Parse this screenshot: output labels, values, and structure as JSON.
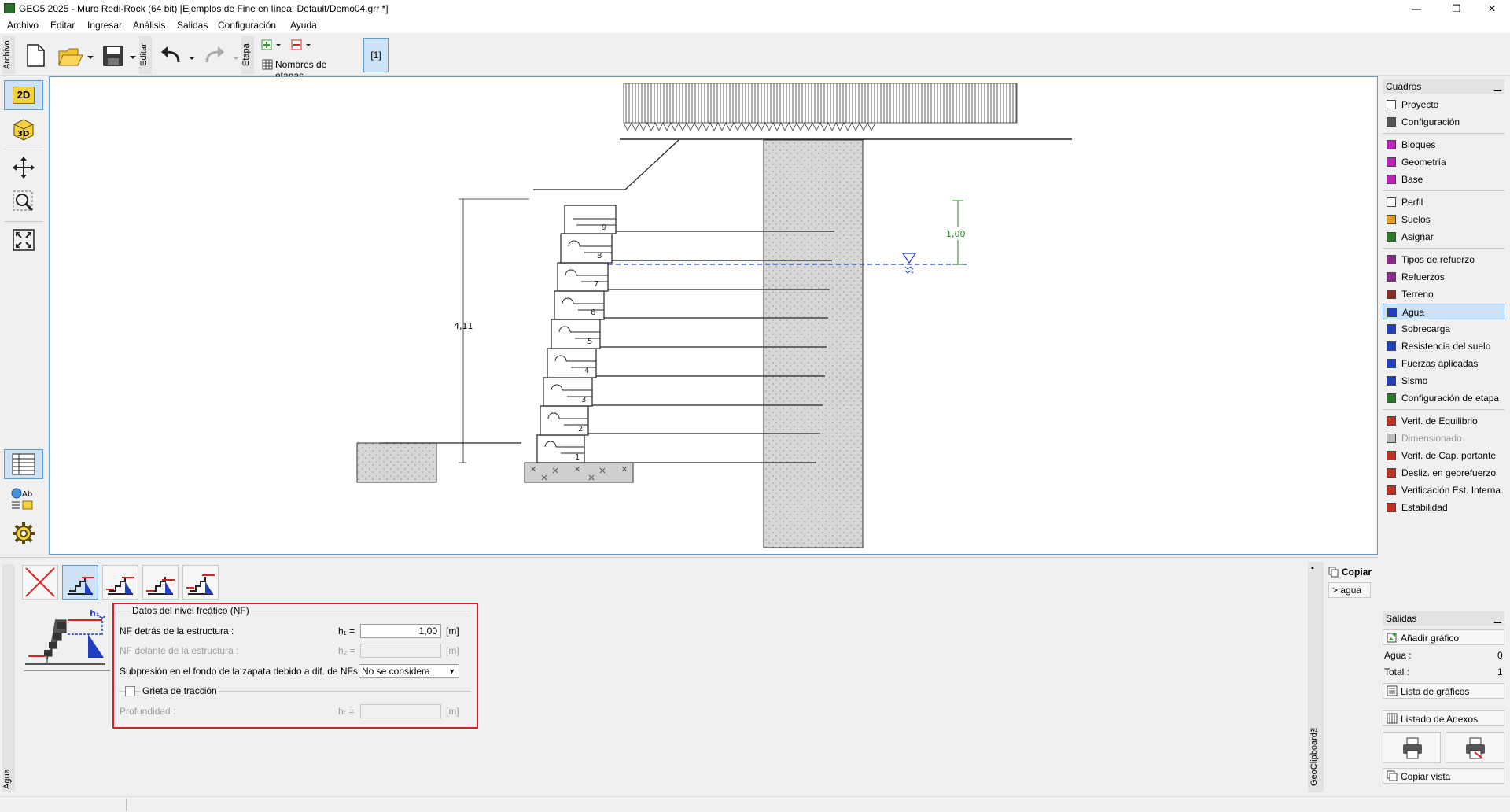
{
  "window": {
    "title": "GEO5 2025 - Muro Redi-Rock  (64 bit) [Ejemplos de Fine en línea: Default/Demo04.grr *]",
    "minimize": "—",
    "restore": "❐",
    "close": "✕"
  },
  "menu": [
    "Archivo",
    "Editar",
    "Ingresar",
    "Análisis",
    "Salidas",
    "Configuración",
    "Ayuda"
  ],
  "toolbar": {
    "archivo_label": "Archivo",
    "editar_label": "Editar",
    "etapa_label": "Etapa",
    "stage_names_label": "Nombres de etapas",
    "stage_button": "[1]"
  },
  "left_tools": {
    "view_2d": "2D",
    "view_3d": "3D",
    "style_label": "Ab"
  },
  "drawing": {
    "height_dim": "4,11",
    "water_dim": "1,00",
    "block_numbers": [
      "1",
      "2",
      "3",
      "4",
      "5",
      "6",
      "7",
      "8",
      "9"
    ]
  },
  "right_panel": {
    "cuadros_title": "Cuadros",
    "groups": [
      [
        "Proyecto",
        "Configuración"
      ],
      [
        "Bloques",
        "Geometría",
        "Base"
      ],
      [
        "Perfil",
        "Suelos",
        "Asignar"
      ],
      [
        "Tipos de refuerzo",
        "Refuerzos",
        "Terreno",
        "Agua",
        "Sobrecarga",
        "Resistencia del suelo",
        "Fuerzas aplicadas",
        "Sismo",
        "Configuración de etapa"
      ],
      [
        "Verif. de Equilibrio",
        "Dimensionado",
        "Verif. de Cap. portante",
        "Desliz. en georefuerzo",
        "Verificación Est. Interna",
        "Estabilidad"
      ]
    ],
    "active_item": "Agua",
    "disabled_item": "Dimensionado",
    "salidas_title": "Salidas",
    "add_graphic": "Añadir gráfico",
    "agua_label": "Agua :",
    "agua_count": "0",
    "total_label": "Total :",
    "total_count": "1",
    "graphics_list": "Lista de gráficos",
    "annex_list": "Listado de Anexos",
    "copy_view": "Copiar vista"
  },
  "bottom_panel": {
    "side_label": "Agua",
    "group_title": "Datos del nivel freático (NF)",
    "nf_behind_label": "NF detrás de la estructura :",
    "nf_behind_sym": "h₁ =",
    "nf_behind_value": "1,00",
    "nf_behind_unit": "[m]",
    "nf_front_label": "NF delante de la estructura :",
    "nf_front_sym": "h₂ =",
    "nf_front_unit": "[m]",
    "uplift_label": "Subpresión en el fondo de la zapata debido a dif. de NFs :",
    "uplift_value": "No se considera",
    "crack_label": "Grieta de tracción",
    "depth_label": "Profundidad :",
    "depth_sym": "hₜ =",
    "depth_unit": "[m]",
    "sketch_label": "h₁",
    "clipboard_label": "GeoClipboard™",
    "copy_label": "Copiar",
    "copy_target": "> agua"
  }
}
